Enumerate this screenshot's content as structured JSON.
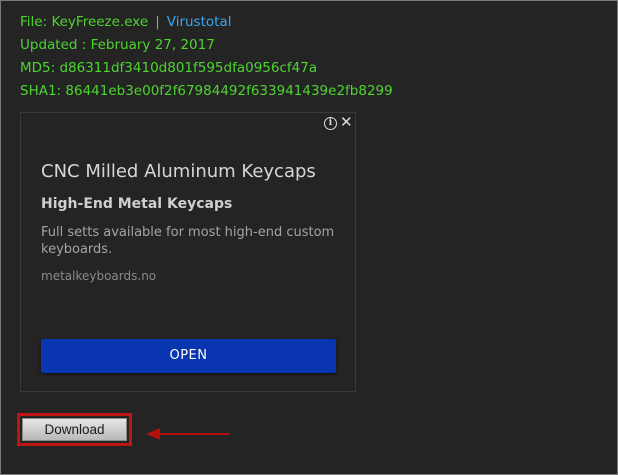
{
  "file_info": {
    "file_prefix": "File: ",
    "file_name": "KeyFreeze.exe",
    "separator": "|",
    "virustotal_label": "Virustotal",
    "updated": "Updated : February 27, 2017",
    "md5": "MD5: d86311df3410d801f595dfa0956cf47a",
    "sha1": "SHA1: 86441eb3e00f2f67984492f633941439e2fb8299"
  },
  "ad": {
    "info_icon": "info-icon",
    "info_glyph": "i",
    "close_icon": "close-icon",
    "close_glyph": "✕",
    "headline": "CNC Milled Aluminum Keycaps",
    "subhead": "High-End Metal Keycaps",
    "body": "Full setts available for most high-end custom keyboards.",
    "domain": "metalkeyboards.no",
    "open_label": "OPEN"
  },
  "download": {
    "label": "Download",
    "highlight_color": "#c11414",
    "arrow_icon": "left-arrow-icon"
  },
  "colors": {
    "background": "#242424",
    "info_text": "#4ed430",
    "link": "#3ea6ee",
    "ad_button": "#0a35b0"
  }
}
